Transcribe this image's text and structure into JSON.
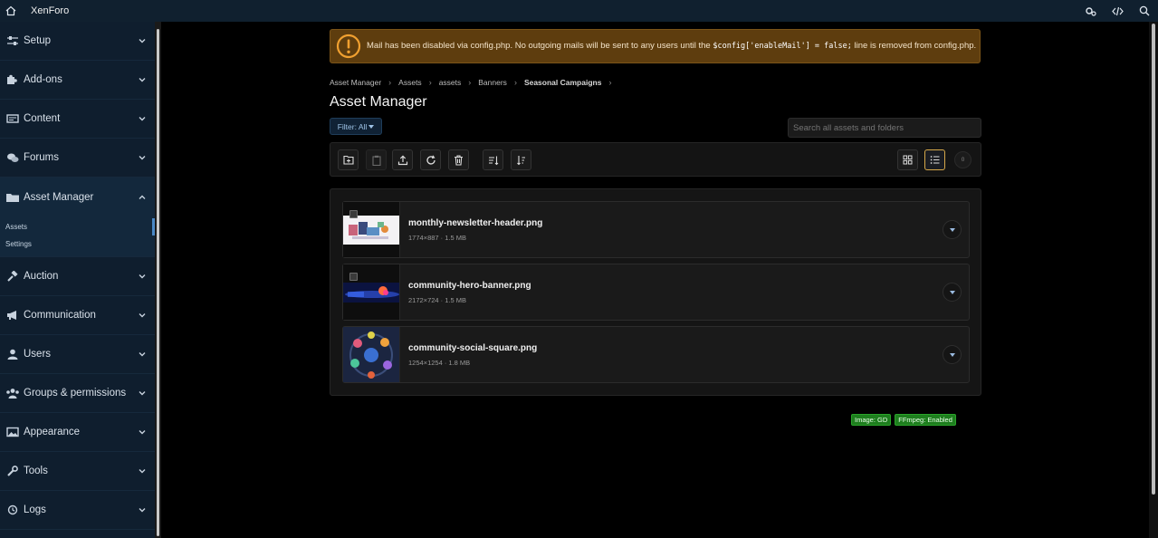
{
  "topbar": {
    "brand": "XenForo",
    "icons": [
      "home-icon",
      "gears-icon",
      "code-icon",
      "search-icon"
    ]
  },
  "sidebar": {
    "items": [
      {
        "label": "Setup",
        "icon": "sliders-icon"
      },
      {
        "label": "Add-ons",
        "icon": "puzzle-icon"
      },
      {
        "label": "Content",
        "icon": "card-icon"
      },
      {
        "label": "Forums",
        "icon": "comments-icon"
      },
      {
        "label": "Asset Manager",
        "icon": "folder-icon"
      },
      {
        "label": "Auction",
        "icon": "gavel-icon"
      },
      {
        "label": "Communication",
        "icon": "megaphone-icon"
      },
      {
        "label": "Users",
        "icon": "user-icon"
      },
      {
        "label": "Groups & permissions",
        "icon": "users-icon"
      },
      {
        "label": "Appearance",
        "icon": "image-icon"
      },
      {
        "label": "Tools",
        "icon": "wrench-icon"
      },
      {
        "label": "Logs",
        "icon": "history-icon"
      }
    ],
    "asset_manager_sub": [
      "Assets",
      "Settings"
    ]
  },
  "notice": {
    "text_before": "Mail has been disabled via config.php. No outgoing mails will be sent to any users until the ",
    "code": "$config['enableMail'] = false;",
    "text_after": " line is removed from config.php."
  },
  "breadcrumb": [
    "Asset Manager",
    "Assets",
    "assets",
    "Banners",
    "Seasonal Campaigns"
  ],
  "page_title": "Asset Manager",
  "filter": {
    "label": "Filter: All"
  },
  "search": {
    "placeholder": "Search all assets and folders"
  },
  "view_count": "0",
  "assets": [
    {
      "name": "monthly-newsletter-header.png",
      "meta": "1774×887 · 1.5 MB"
    },
    {
      "name": "community-hero-banner.png",
      "meta": "2172×724 · 1.5 MB"
    },
    {
      "name": "community-social-square.png",
      "meta": "1254×1254 · 1.8 MB"
    }
  ],
  "badges": [
    "Image: GD",
    "FFmpeg: Enabled"
  ],
  "colors": {
    "sidebar_bg": "#0f1e2e",
    "topbar_bg": "#10202f",
    "notice_bg": "#5e3d0e",
    "badge_green": "#1e7e1e",
    "active_accent": "#d6a84a"
  }
}
